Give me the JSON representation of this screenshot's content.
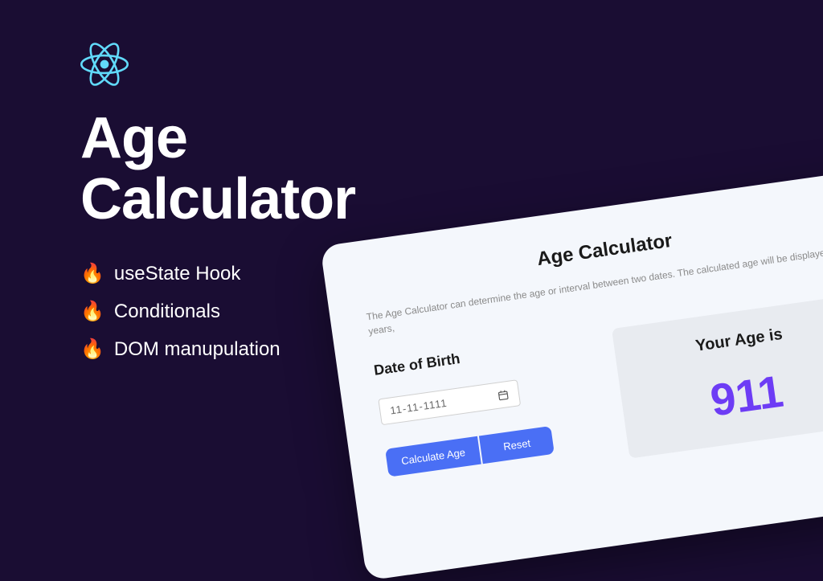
{
  "main_title": "Age\nCalculator",
  "features": [
    "useState Hook",
    "Conditionals",
    "DOM manupulation"
  ],
  "app": {
    "title": "Age Calculator",
    "description": "The Age Calculator can determine the age or interval between two dates. The calculated age will be displayed in years,",
    "date_label": "Date of Birth",
    "date_value": "11-11-1111",
    "calculate_btn": "Calculate Age",
    "reset_btn": "Reset",
    "result_label": "Your Age is",
    "result_value": "911"
  }
}
